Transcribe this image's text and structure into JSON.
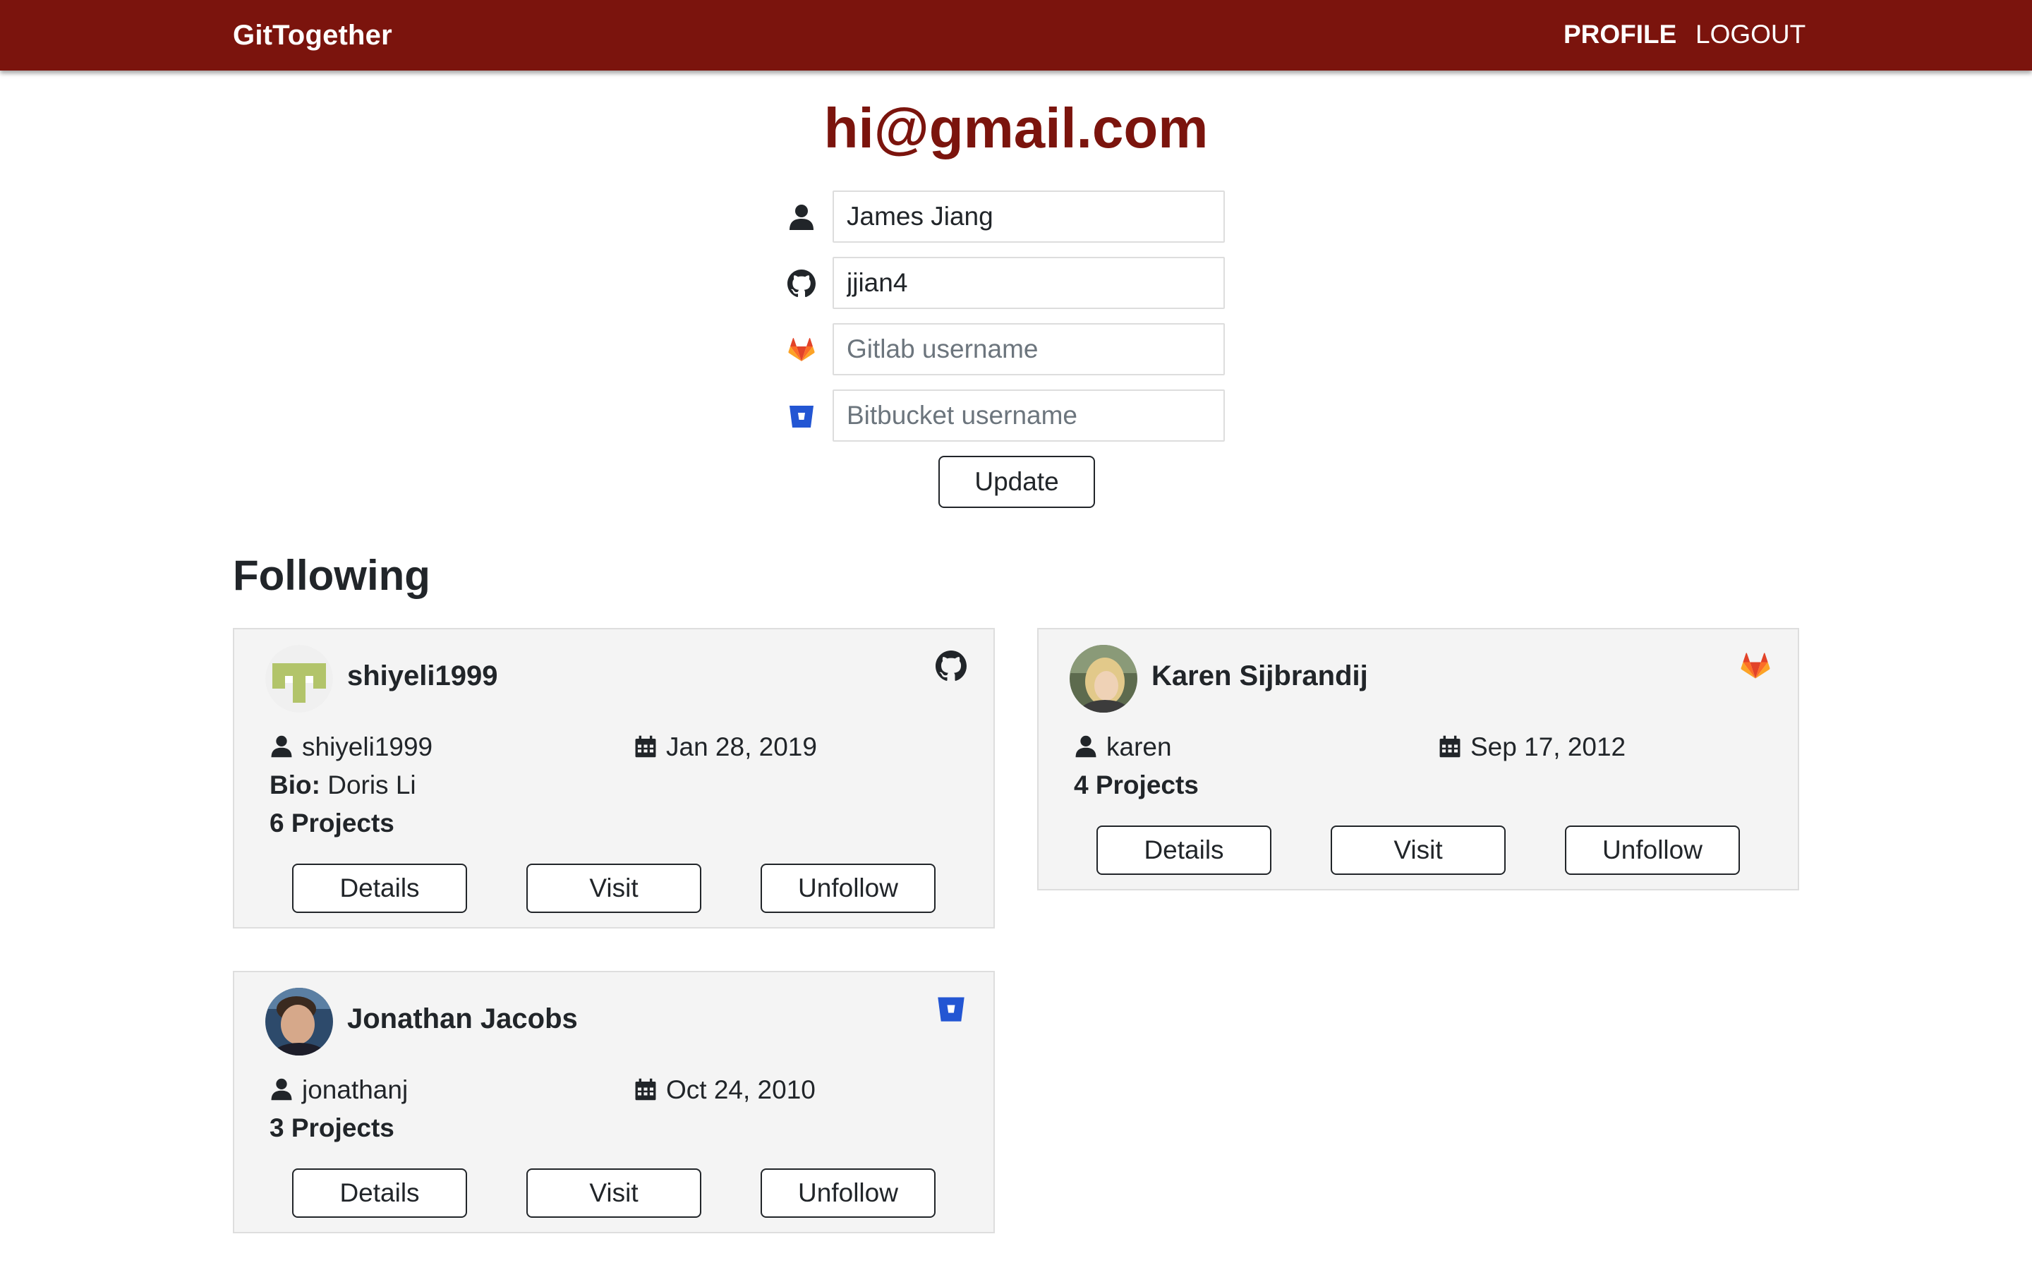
{
  "nav": {
    "brand": "GitTogether",
    "profile_label": "PROFILE",
    "logout_label": "LOGOUT"
  },
  "profile": {
    "email": "hi@gmail.com",
    "name_value": "James Jiang",
    "github_value": "jjian4",
    "gitlab_value": "",
    "gitlab_placeholder": "Gitlab username",
    "bitbucket_value": "",
    "bitbucket_placeholder": "Bitbucket username",
    "update_label": "Update"
  },
  "following": {
    "title": "Following",
    "cards": [
      {
        "name": "shiyeli1999",
        "username": "shiyeli1999",
        "date": "Jan 28, 2019",
        "bio_label": "Bio:",
        "bio": "Doris Li",
        "projects": "6 Projects",
        "source": "github-icon",
        "details_label": "Details",
        "visit_label": "Visit",
        "unfollow_label": "Unfollow"
      },
      {
        "name": "Karen Sijbrandij",
        "username": "karen",
        "date": "Sep 17, 2012",
        "projects": "4 Projects",
        "source": "gitlab-icon",
        "details_label": "Details",
        "visit_label": "Visit",
        "unfollow_label": "Unfollow"
      },
      {
        "name": "Jonathan Jacobs",
        "username": "jonathanj",
        "date": "Oct 24, 2010",
        "projects": "3 Projects",
        "source": "bitbucket-icon",
        "details_label": "Details",
        "visit_label": "Visit",
        "unfollow_label": "Unfollow"
      }
    ]
  },
  "colors": {
    "brand": "#7b140d",
    "gitlab": "#e24329",
    "bitbucket": "#2356d3",
    "card_bg": "#f4f4f4"
  }
}
